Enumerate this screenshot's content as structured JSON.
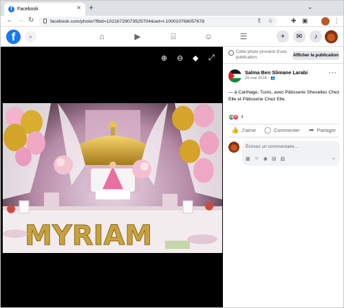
{
  "browser": {
    "tab_title": "Facebook",
    "tab_close": "✕",
    "new_tab": "+",
    "url": "facebook.com/photo/?fbid=10216729073525704&set=t.100010768057678",
    "minimize": "—",
    "maximize": "☐",
    "close": "✕"
  },
  "fb": {
    "logo": "f"
  },
  "viewer": {
    "photo_banner_text": "MYRIAM"
  },
  "panel": {
    "notice": "Cette photo provient d’une publication.",
    "show_post": "Afficher la publication",
    "author": "Salma Ben Slimane Larabi",
    "date": "20 mai 2018 ·",
    "more": "···",
    "post_text": "— à Carthage, Tunis, avec Pâtisserie Sheselles Chez Elle et Pâtisserie Chez Elle.",
    "reaction_count": "4",
    "like": "J’aime",
    "comment": "Commenter",
    "share": "Partager",
    "comment_placeholder": "Écrivez un commentaire…"
  },
  "colors": {
    "fb_blue": "#1877f2",
    "like_blue": "#1877f2",
    "love_red": "#f33e58"
  }
}
